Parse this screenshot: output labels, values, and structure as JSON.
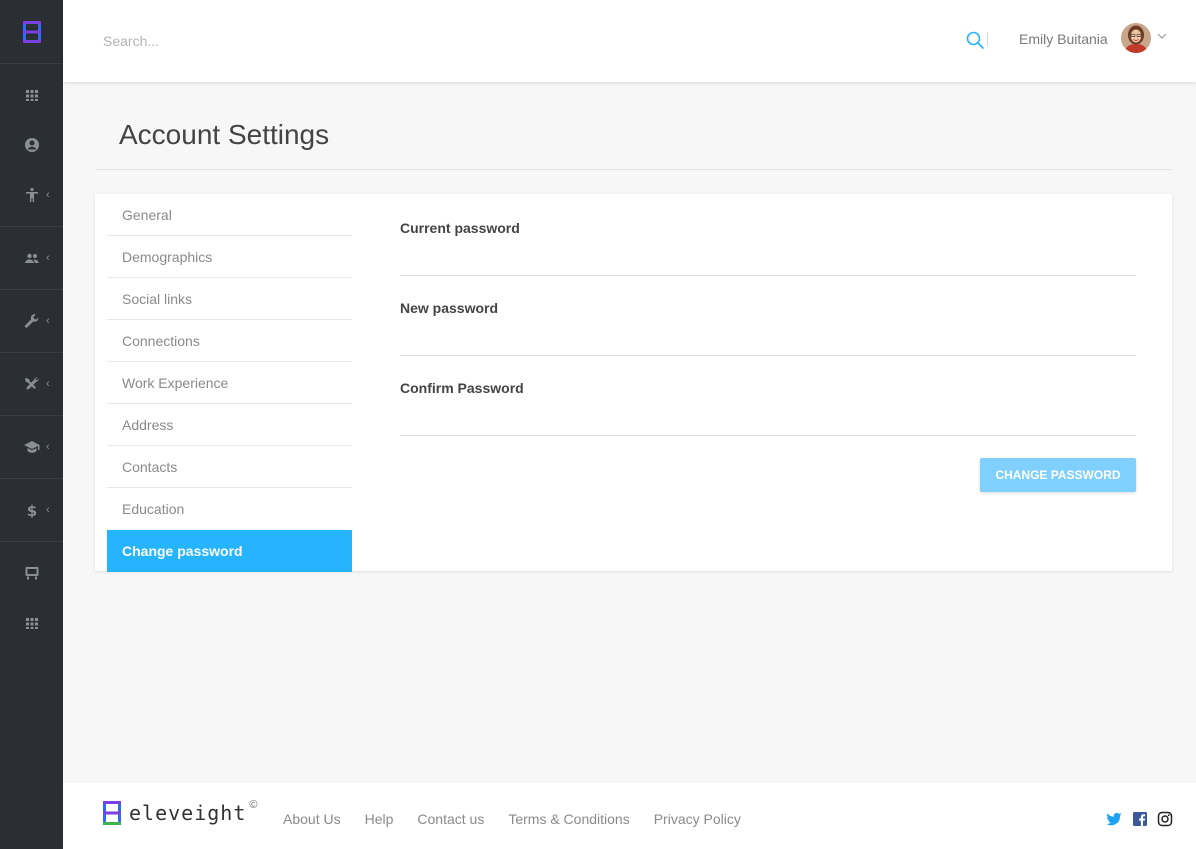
{
  "header": {
    "search_placeholder": "Search...",
    "user_name": "Emily Buitania"
  },
  "page": {
    "title": "Account Settings"
  },
  "menu": [
    {
      "label": "General"
    },
    {
      "label": "Demographics"
    },
    {
      "label": "Social links"
    },
    {
      "label": "Connections"
    },
    {
      "label": "Work Experience"
    },
    {
      "label": "Address"
    },
    {
      "label": "Contacts"
    },
    {
      "label": "Education"
    },
    {
      "label": "Change password",
      "active": true
    }
  ],
  "form": {
    "current_password_label": "Current password",
    "new_password_label": "New password",
    "confirm_password_label": "Confirm Password",
    "submit_label": "CHANGE PASSWORD"
  },
  "footer": {
    "brand": "eleveight",
    "copyright": "©",
    "links": [
      "About Us",
      "Help",
      "Contact us",
      "Terms & Conditions",
      "Privacy Policy"
    ]
  },
  "colors": {
    "sidebar": "#2b2e33",
    "accent": "#26b4ff",
    "button": "#7fd0ff"
  },
  "icons": {
    "sidebar": [
      "apps-icon",
      "account-circle-icon",
      "accessibility-icon",
      "people-icon",
      "wrench-icon",
      "tools-icon",
      "graduation-cap-icon",
      "dollar-icon",
      "presentation-icon",
      "grid-icon"
    ],
    "social": [
      "twitter-icon",
      "facebook-icon",
      "instagram-icon"
    ]
  }
}
